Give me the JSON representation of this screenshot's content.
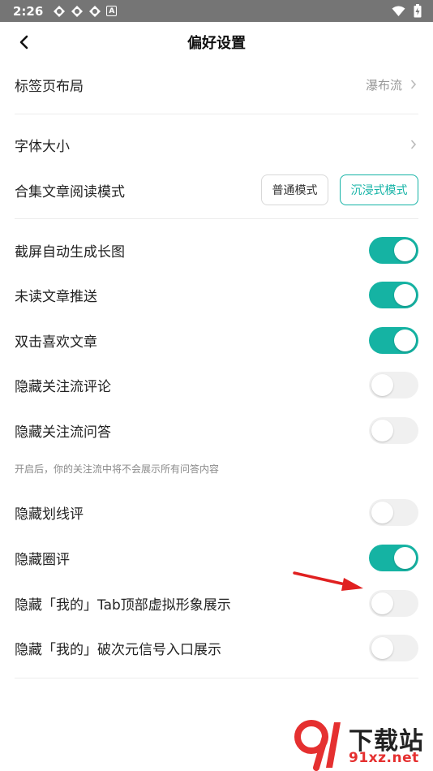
{
  "status_bar": {
    "time": "2:26",
    "indicator": "A"
  },
  "nav": {
    "title": "偏好设置"
  },
  "layout_row": {
    "label": "标签页布局",
    "value": "瀑布流"
  },
  "font_row": {
    "label": "字体大小"
  },
  "reading_mode": {
    "label": "合集文章阅读模式",
    "options": [
      "普通模式",
      "沉浸式模式"
    ],
    "selected": "沉浸式模式"
  },
  "toggles": [
    {
      "label": "截屏自动生成长图",
      "on": true
    },
    {
      "label": "未读文章推送",
      "on": true
    },
    {
      "label": "双击喜欢文章",
      "on": true
    },
    {
      "label": "隐藏关注流评论",
      "on": false
    },
    {
      "label": "隐藏关注流问答",
      "on": false
    },
    {
      "label": "隐藏划线评",
      "on": false
    },
    {
      "label": "隐藏圈评",
      "on": true
    },
    {
      "label": "隐藏「我的」Tab顶部虚拟形象展示",
      "on": false
    },
    {
      "label": "隐藏「我的」破次元信号入口展示",
      "on": false
    }
  ],
  "hint": "开启后，你的关注流中将不会展示所有问答内容",
  "colors": {
    "accent": "#15b3a3",
    "toggle_off": "#f0f0f0",
    "annotation_arrow": "#e02020"
  },
  "watermark": {
    "brand": "下载站",
    "url": "91xz.net"
  }
}
